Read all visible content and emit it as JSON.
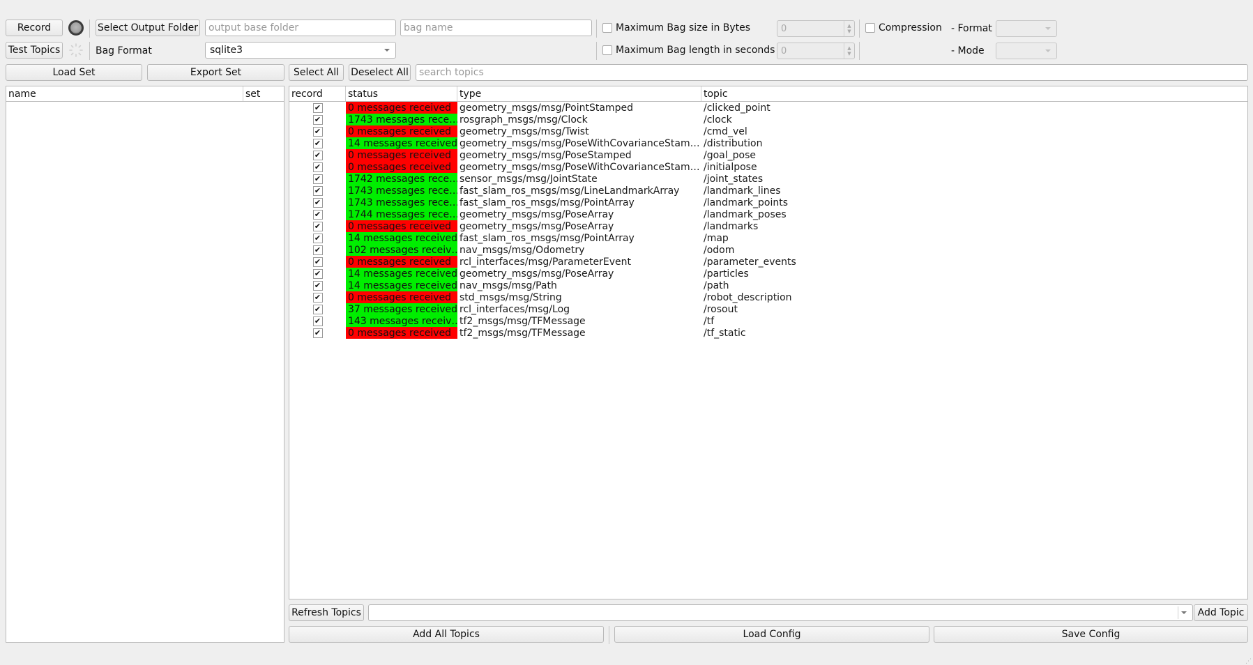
{
  "toolbar": {
    "record_label": "Record",
    "test_topics_label": "Test Topics",
    "select_output_folder_label": "Select Output Folder",
    "output_folder_placeholder": "output base folder",
    "bag_name_placeholder": "bag name",
    "bag_format_label": "Bag Format",
    "bag_format_value": "sqlite3",
    "max_size_label": "Maximum Bag size in Bytes",
    "max_size_value": "0",
    "max_length_label": "Maximum Bag length in seconds",
    "max_length_value": "0",
    "compression_label": "Compression",
    "format_label": "- Format",
    "mode_label": "- Mode",
    "format_value": "",
    "mode_value": ""
  },
  "sets": {
    "load_label": "Load Set",
    "export_label": "Export Set",
    "columns": [
      "name",
      "set"
    ],
    "rows": []
  },
  "topics_bar": {
    "select_all_label": "Select All",
    "deselect_all_label": "Deselect All",
    "search_placeholder": "search topics"
  },
  "topics_table": {
    "columns": [
      "record",
      "status",
      "type",
      "topic"
    ],
    "colors": {
      "ok": "#00ee00",
      "none": "#ff0000"
    },
    "rows": [
      {
        "record": true,
        "status": "0 messages received",
        "ok": false,
        "type": "geometry_msgs/msg/PointStamped",
        "topic": "/clicked_point"
      },
      {
        "record": true,
        "status": "1743 messages rece…",
        "ok": true,
        "type": "rosgraph_msgs/msg/Clock",
        "topic": "/clock"
      },
      {
        "record": true,
        "status": "0 messages received",
        "ok": false,
        "type": "geometry_msgs/msg/Twist",
        "topic": "/cmd_vel"
      },
      {
        "record": true,
        "status": "14 messages received",
        "ok": true,
        "type": "geometry_msgs/msg/PoseWithCovarianceStam…",
        "topic": "/distribution"
      },
      {
        "record": true,
        "status": "0 messages received",
        "ok": false,
        "type": "geometry_msgs/msg/PoseStamped",
        "topic": "/goal_pose"
      },
      {
        "record": true,
        "status": "0 messages received",
        "ok": false,
        "type": "geometry_msgs/msg/PoseWithCovarianceStam…",
        "topic": "/initialpose"
      },
      {
        "record": true,
        "status": "1742 messages rece…",
        "ok": true,
        "type": "sensor_msgs/msg/JointState",
        "topic": "/joint_states"
      },
      {
        "record": true,
        "status": "1743 messages rece…",
        "ok": true,
        "type": "fast_slam_ros_msgs/msg/LineLandmarkArray",
        "topic": "/landmark_lines"
      },
      {
        "record": true,
        "status": "1743 messages rece…",
        "ok": true,
        "type": "fast_slam_ros_msgs/msg/PointArray",
        "topic": "/landmark_points"
      },
      {
        "record": true,
        "status": "1744 messages rece…",
        "ok": true,
        "type": "geometry_msgs/msg/PoseArray",
        "topic": "/landmark_poses"
      },
      {
        "record": true,
        "status": "0 messages received",
        "ok": false,
        "type": "geometry_msgs/msg/PoseArray",
        "topic": "/landmarks"
      },
      {
        "record": true,
        "status": "14 messages received",
        "ok": true,
        "type": "fast_slam_ros_msgs/msg/PointArray",
        "topic": "/map"
      },
      {
        "record": true,
        "status": "102 messages receiv…",
        "ok": true,
        "type": "nav_msgs/msg/Odometry",
        "topic": "/odom"
      },
      {
        "record": true,
        "status": "0 messages received",
        "ok": false,
        "type": "rcl_interfaces/msg/ParameterEvent",
        "topic": "/parameter_events"
      },
      {
        "record": true,
        "status": "14 messages received",
        "ok": true,
        "type": "geometry_msgs/msg/PoseArray",
        "topic": "/particles"
      },
      {
        "record": true,
        "status": "14 messages received",
        "ok": true,
        "type": "nav_msgs/msg/Path",
        "topic": "/path"
      },
      {
        "record": true,
        "status": "0 messages received",
        "ok": false,
        "type": "std_msgs/msg/String",
        "topic": "/robot_description"
      },
      {
        "record": true,
        "status": "37 messages received",
        "ok": true,
        "type": "rcl_interfaces/msg/Log",
        "topic": "/rosout"
      },
      {
        "record": true,
        "status": "143 messages receiv…",
        "ok": true,
        "type": "tf2_msgs/msg/TFMessage",
        "topic": "/tf"
      },
      {
        "record": true,
        "status": "0 messages received",
        "ok": false,
        "type": "tf2_msgs/msg/TFMessage",
        "topic": "/tf_static"
      }
    ]
  },
  "bottom": {
    "refresh_topics_label": "Refresh Topics",
    "topic_combo_value": "",
    "add_topic_label": "Add Topic",
    "add_all_topics_label": "Add All Topics",
    "load_config_label": "Load Config",
    "save_config_label": "Save Config"
  },
  "icons": {
    "record_indicator": "record-status-indicator",
    "busy_spinner": "loading-spinner",
    "check": "✔"
  }
}
